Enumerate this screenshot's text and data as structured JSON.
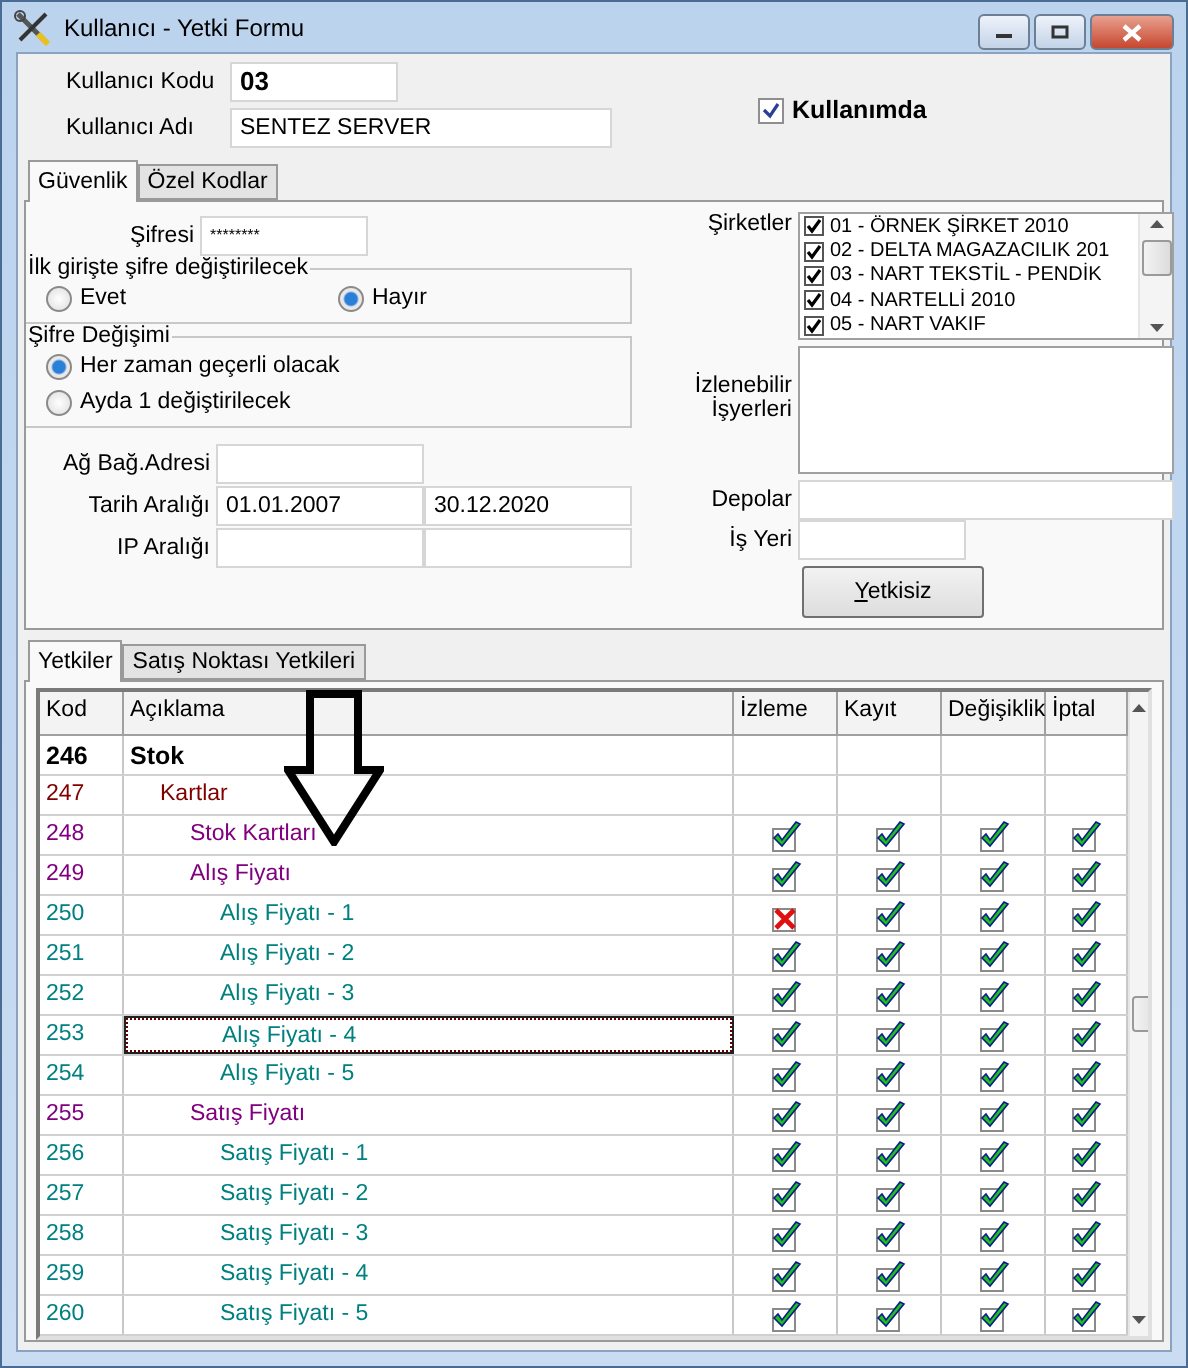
{
  "window": {
    "title": "Kullanıcı - Yetki Formu"
  },
  "user_code": {
    "label": "Kullanıcı Kodu",
    "value": "03"
  },
  "user_name": {
    "label": "Kullanıcı Adı",
    "value": "SENTEZ SERVER"
  },
  "in_use": {
    "label": "Kullanımda",
    "checked": true
  },
  "top_tabs": [
    {
      "label": "Güvenlik",
      "selected": true
    },
    {
      "label": "Özel Kodlar",
      "selected": false
    }
  ],
  "password": {
    "label": "Şifresi",
    "value": "********"
  },
  "first_login_group": {
    "title": "İlk girişte şifre değiştirilecek",
    "options": [
      {
        "label": "Evet",
        "selected": false
      },
      {
        "label": "Hayır",
        "selected": true
      }
    ]
  },
  "password_change_group": {
    "title": "Şifre Değişimi",
    "options": [
      {
        "label": "Her zaman geçerli olacak",
        "selected": true
      },
      {
        "label": "Ayda 1 değiştirilecek",
        "selected": false
      }
    ]
  },
  "network_address": {
    "label": "Ağ Bağ.Adresi"
  },
  "date_range": {
    "label": "Tarih Aralığı",
    "values": [
      "01.01.2007",
      "30.12.2020"
    ]
  },
  "ip_range": {
    "label": "IP Aralığı"
  },
  "companies": {
    "label": "Şirketler",
    "items": [
      {
        "label": "01 - ÖRNEK ŞİRKET 2010",
        "checked": true
      },
      {
        "label": "02 - DELTA MAGAZACILIK 201",
        "checked": true
      },
      {
        "label": "03 - NART TEKSTİL - PENDİK",
        "checked": true
      },
      {
        "label": "04 - NARTELLİ  2010",
        "checked": true
      },
      {
        "label": "05 - NART VAKIF",
        "checked": true
      }
    ]
  },
  "workplaces": {
    "label": "İzlenebilir\nİşyerleri"
  },
  "depots": {
    "label": "Depolar"
  },
  "workplace": {
    "label": "İş Yeri"
  },
  "unauthorized_button": {
    "label": "Yetkisiz"
  },
  "bottom_tabs": [
    {
      "label": "Yetkiler",
      "selected": true
    },
    {
      "label": "Satış Noktası Yetkileri",
      "selected": false
    }
  ],
  "columns": [
    "Kod",
    "Açıklama",
    "İzleme",
    "Kayıt",
    "Değişiklik",
    "İptal"
  ],
  "rows": [
    {
      "code": "246",
      "description": "Stok",
      "selected": false,
      "children": [
        {
          "code": "247",
          "description": "Kartlar",
          "selected": false,
          "children": [
            {
              "code": "248",
              "description": "Stok Kartları",
              "selected": false,
              "permissions": [
                true,
                true,
                true,
                true
              ]
            },
            {
              "code": "249",
              "description": "Alış Fiyatı",
              "selected": false,
              "permissions": [
                true,
                true,
                true,
                true
              ],
              "children": [
                {
                  "code": "250",
                  "description": "Alış Fiyatı - 1",
                  "selected": false,
                  "permissions": [
                    false,
                    true,
                    true,
                    true
                  ]
                },
                {
                  "code": "251",
                  "description": "Alış Fiyatı - 2",
                  "selected": false,
                  "permissions": [
                    true,
                    true,
                    true,
                    true
                  ]
                },
                {
                  "code": "252",
                  "description": "Alış Fiyatı - 3",
                  "selected": false,
                  "permissions": [
                    true,
                    true,
                    true,
                    true
                  ]
                },
                {
                  "code": "253",
                  "description": "Alış Fiyatı - 4",
                  "selected": true,
                  "permissions": [
                    true,
                    true,
                    true,
                    true
                  ]
                },
                {
                  "code": "254",
                  "description": "Alış Fiyatı - 5",
                  "selected": false,
                  "permissions": [
                    true,
                    true,
                    true,
                    true
                  ]
                }
              ]
            },
            {
              "code": "255",
              "description": "Satış Fiyatı",
              "selected": false,
              "permissions": [
                true,
                true,
                true,
                true
              ],
              "children": [
                {
                  "code": "256",
                  "description": "Satış Fiyatı - 1",
                  "selected": false,
                  "permissions": [
                    true,
                    true,
                    true,
                    true
                  ]
                },
                {
                  "code": "257",
                  "description": "Satış Fiyatı - 2",
                  "selected": false,
                  "permissions": [
                    true,
                    true,
                    true,
                    true
                  ]
                },
                {
                  "code": "258",
                  "description": "Satış Fiyatı - 3",
                  "selected": false,
                  "permissions": [
                    true,
                    true,
                    true,
                    true
                  ]
                },
                {
                  "code": "259",
                  "description": "Satış Fiyatı - 4",
                  "selected": false,
                  "permissions": [
                    true,
                    true,
                    true,
                    true
                  ]
                },
                {
                  "code": "260",
                  "description": "Satış Fiyatı - 5",
                  "selected": false,
                  "permissions": [
                    true,
                    true,
                    true,
                    true
                  ]
                }
              ]
            }
          ]
        }
      ]
    }
  ]
}
